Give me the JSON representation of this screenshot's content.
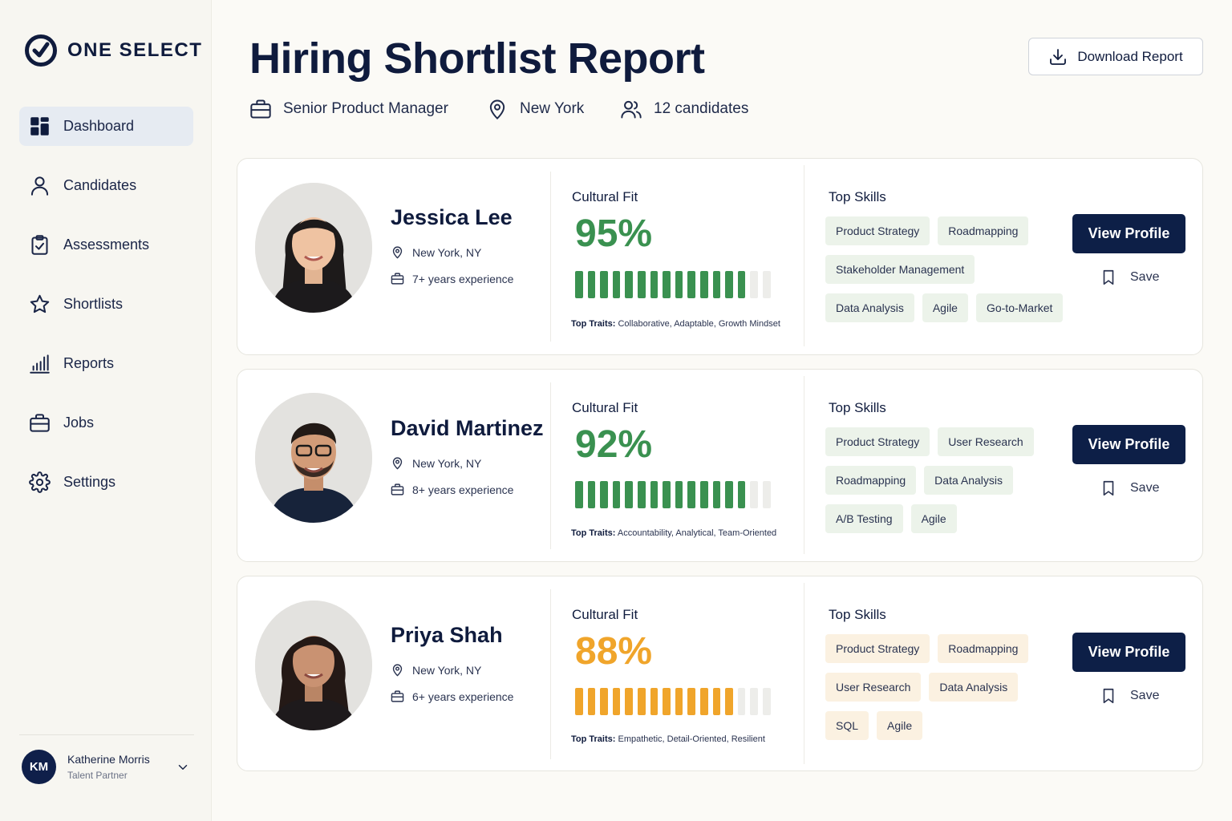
{
  "brand": {
    "name": "ONE SELECT"
  },
  "nav": [
    {
      "label": "Dashboard",
      "icon": "grid-icon",
      "active": true
    },
    {
      "label": "Candidates",
      "icon": "user-icon"
    },
    {
      "label": "Assessments",
      "icon": "clipboard-check-icon"
    },
    {
      "label": "Shortlists",
      "icon": "star-icon"
    },
    {
      "label": "Reports",
      "icon": "bar-chart-icon"
    },
    {
      "label": "Jobs",
      "icon": "briefcase-icon"
    },
    {
      "label": "Settings",
      "icon": "gear-icon"
    }
  ],
  "user": {
    "initials": "KM",
    "name": "Katherine Morris",
    "role": "Talent Partner"
  },
  "header": {
    "title": "Hiring Shortlist Report",
    "role": "Senior Product Manager",
    "location": "New York",
    "candidates": "12 candidates",
    "download_label": "Download Report"
  },
  "labels": {
    "cultural_fit": "Cultural Fit",
    "top_skills": "Top Skills",
    "top_traits": "Top Traits:",
    "view_profile": "View Profile",
    "save": "Save"
  },
  "colors": {
    "green": "#3a9150",
    "amber": "#f0a52b",
    "navy": "#0d1f47"
  },
  "candidates": [
    {
      "name": "Jessica Lee",
      "location": "New York, NY",
      "experience": "7+ years experience",
      "fit": "95%",
      "fit_filled": 14,
      "fit_total": 16,
      "tone": "green",
      "traits": "Collaborative, Adaptable, Growth Mindset",
      "skills": [
        "Product Strategy",
        "Roadmapping",
        "Stakeholder Management",
        "Data Analysis",
        "Agile",
        "Go-to-Market"
      ]
    },
    {
      "name": "David Martinez",
      "location": "New York, NY",
      "experience": "8+ years experience",
      "fit": "92%",
      "fit_filled": 14,
      "fit_total": 16,
      "tone": "green",
      "traits": "Accountability, Analytical, Team-Oriented",
      "skills": [
        "Product Strategy",
        "User Research",
        "Roadmapping",
        "Data Analysis",
        "A/B Testing",
        "Agile"
      ]
    },
    {
      "name": "Priya Shah",
      "location": "New York, NY",
      "experience": "6+ years experience",
      "fit": "88%",
      "fit_filled": 13,
      "fit_total": 16,
      "tone": "amber",
      "traits": "Empathetic, Detail-Oriented, Resilient",
      "skills": [
        "Product Strategy",
        "Roadmapping",
        "User Research",
        "Data Analysis",
        "SQL",
        "Agile"
      ]
    }
  ]
}
